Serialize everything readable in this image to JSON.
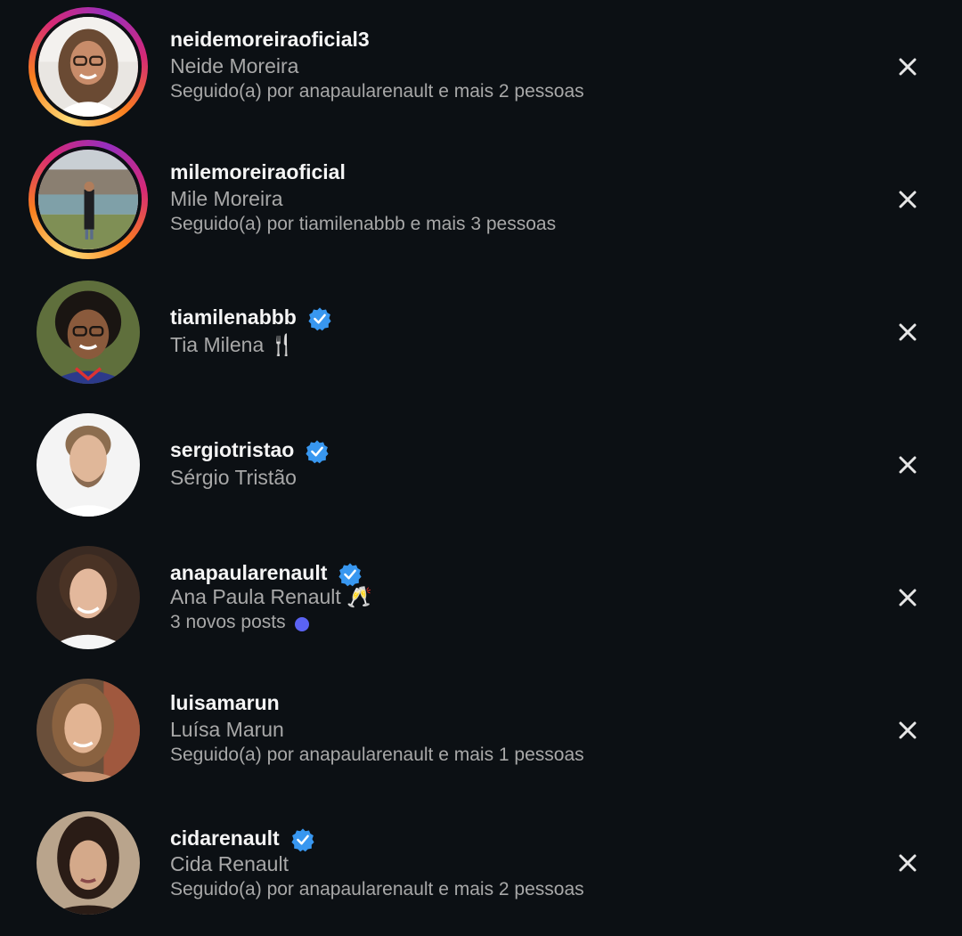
{
  "suggestions": [
    {
      "username": "neidemoreiraoficial3",
      "full_name": "Neide Moreira",
      "subtext": "Seguido(a) por anapaularenault e mais 2 pessoas",
      "verified": false,
      "has_story": true,
      "avatar": "woman-glasses-curly-hair-photo"
    },
    {
      "username": "milemoreiraoficial",
      "full_name": "Mile Moreira",
      "subtext": "Seguido(a) por tiamilenabbb e mais 3 pessoas",
      "verified": false,
      "has_story": true,
      "avatar": "woman-standing-in-park-photo"
    },
    {
      "username": "tiamilenabbb",
      "full_name": "Tia Milena 🍴",
      "verified": true,
      "has_story": false,
      "avatar": "woman-glasses-curly-hair-smiling-photo"
    },
    {
      "username": "sergiotristao",
      "full_name": "Sérgio Tristão",
      "verified": true,
      "has_story": false,
      "avatar": "man-beard-white-background-photo"
    },
    {
      "username": "anapaularenault",
      "full_name": "Ana Paula Renault 🥂",
      "subtext": "3 novos posts",
      "verified": true,
      "has_story": false,
      "avatar": "woman-white-shirt-smiling-photo"
    },
    {
      "username": "luisamarun",
      "full_name": "Luísa Marun",
      "subtext": "Seguido(a) por anapaularenault e mais 1 pessoas",
      "verified": false,
      "has_story": false,
      "avatar": "woman-long-hair-selfie-photo"
    },
    {
      "username": "cidarenault",
      "full_name": "Cida Renault",
      "subtext": "Seguido(a) por anapaularenault e mais 2 pessoas",
      "verified": true,
      "has_story": false,
      "avatar": "woman-dark-hair-selfie-photo"
    }
  ],
  "icons": {
    "verified": "verified-badge-icon",
    "dismiss": "close-icon",
    "new_posts_dot": "unread-dot-icon"
  },
  "colors": {
    "background": "#0c1014",
    "primary_text": "#f5f5f5",
    "secondary_text": "#a8a8a8",
    "verified_blue": "#3897f0",
    "unread_dot": "#5b63f3"
  }
}
